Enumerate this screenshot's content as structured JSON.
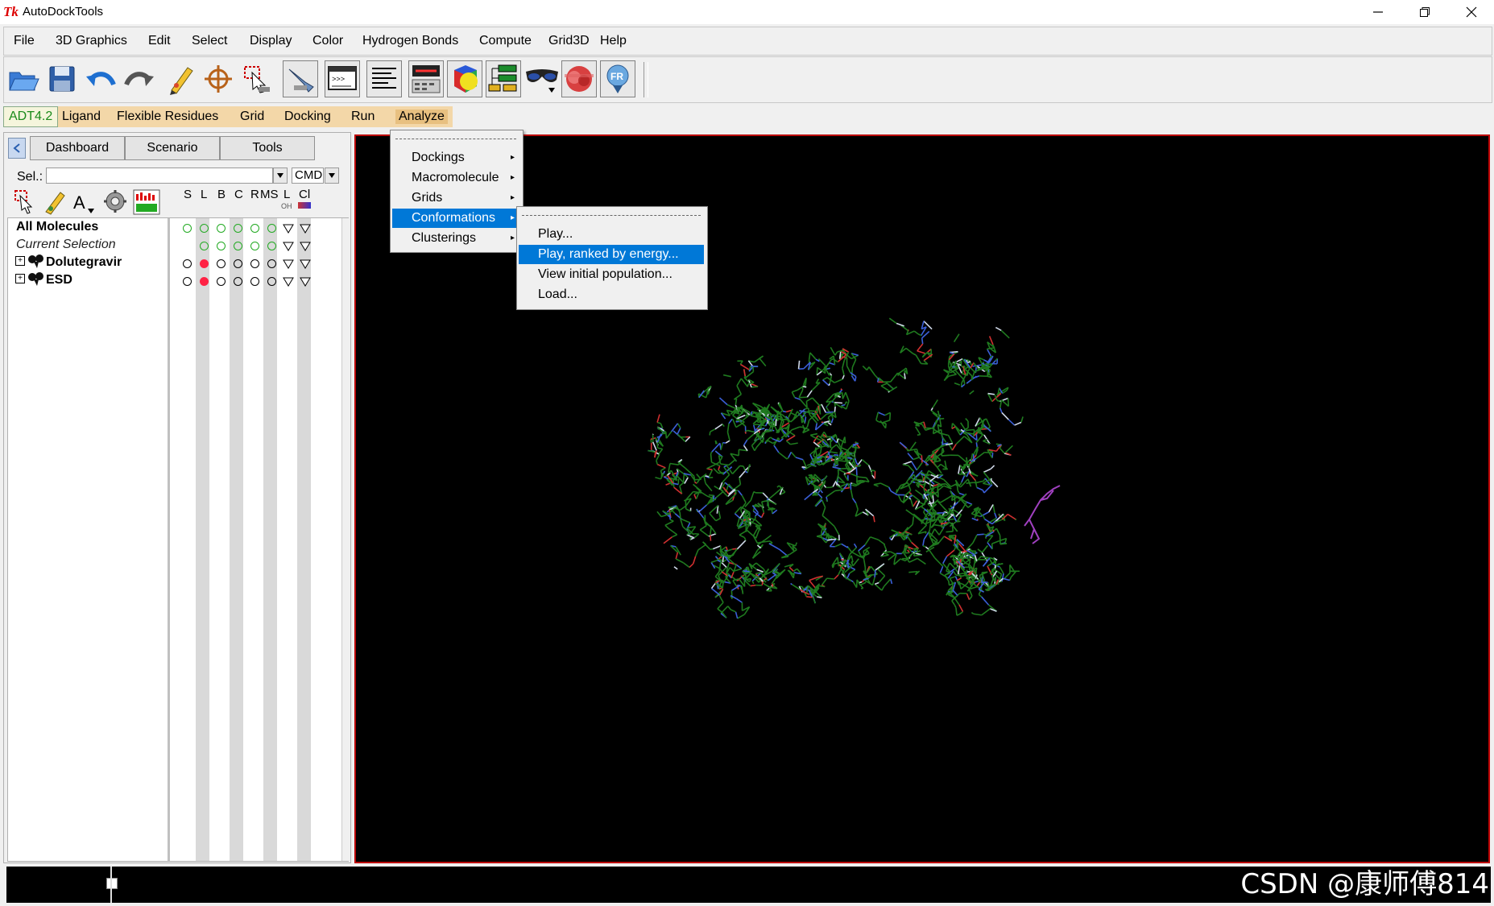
{
  "window": {
    "app_icon": "Tk",
    "title": "AutoDockTools",
    "controls": [
      "minimize-icon",
      "restore-icon",
      "close-icon"
    ]
  },
  "menubar": {
    "items": [
      "File",
      "3D Graphics",
      "Edit",
      "Select",
      "Display",
      "Color",
      "Hydrogen Bonds",
      "Compute",
      "Grid3D",
      "Help"
    ]
  },
  "toolbar": {
    "icons": [
      "open-folder-icon",
      "save-icon",
      "undo-icon",
      "redo-icon",
      "pencil-icon",
      "crosshair-icon",
      "selection-icon",
      "pen-tool-icon",
      "python-shell-icon",
      "text-lines-icon",
      "sequence-viewer-icon",
      "color-cube-icon",
      "tree-icon",
      "stereo-glasses-icon",
      "lens-icon",
      "fr-balloon-icon"
    ]
  },
  "adt_tabs": {
    "version": "ADT4.2",
    "items": [
      "Ligand",
      "Flexible Residues",
      "Grid",
      "Docking",
      "Run",
      "Analyze"
    ]
  },
  "dashboard": {
    "tabs": [
      "Dashboard",
      "Scenario",
      "Tools"
    ],
    "sel_label": "Sel.:",
    "sel_value": "",
    "cmd_label": "CMD",
    "column_headers": [
      "S",
      "L",
      "B",
      "C",
      "R",
      "MS",
      "L",
      "Cl"
    ],
    "column_subtexts": [
      "OH"
    ],
    "rows": [
      {
        "label": "All Molecules",
        "style": "bold"
      },
      {
        "label": "Current Selection",
        "style": "italic"
      },
      {
        "label": "Dolutegravir",
        "style": "bold"
      },
      {
        "label": "ESD",
        "style": "bold"
      }
    ]
  },
  "analyze_menu": {
    "items": [
      {
        "label": "Dockings",
        "has_submenu": true
      },
      {
        "label": "Macromolecule",
        "has_submenu": true
      },
      {
        "label": "Grids",
        "has_submenu": true
      },
      {
        "label": "Conformations",
        "has_submenu": true,
        "highlighted": true
      },
      {
        "label": "Clusterings",
        "has_submenu": true
      }
    ]
  },
  "conformations_submenu": {
    "items": [
      {
        "label": "Play..."
      },
      {
        "label": "Play, ranked by energy...",
        "highlighted": true
      },
      {
        "label": "View initial population..."
      },
      {
        "label": "Load..."
      }
    ]
  },
  "watermark": "CSDN @康师傅814",
  "colors": {
    "accent": "#0078d7",
    "viewer_bg": "#000000",
    "viewer_border": "#bb0000",
    "tab_bar": "#f3d7a8",
    "protein_green": "#1f7a1f",
    "ligand_purple": "#a040c0"
  }
}
